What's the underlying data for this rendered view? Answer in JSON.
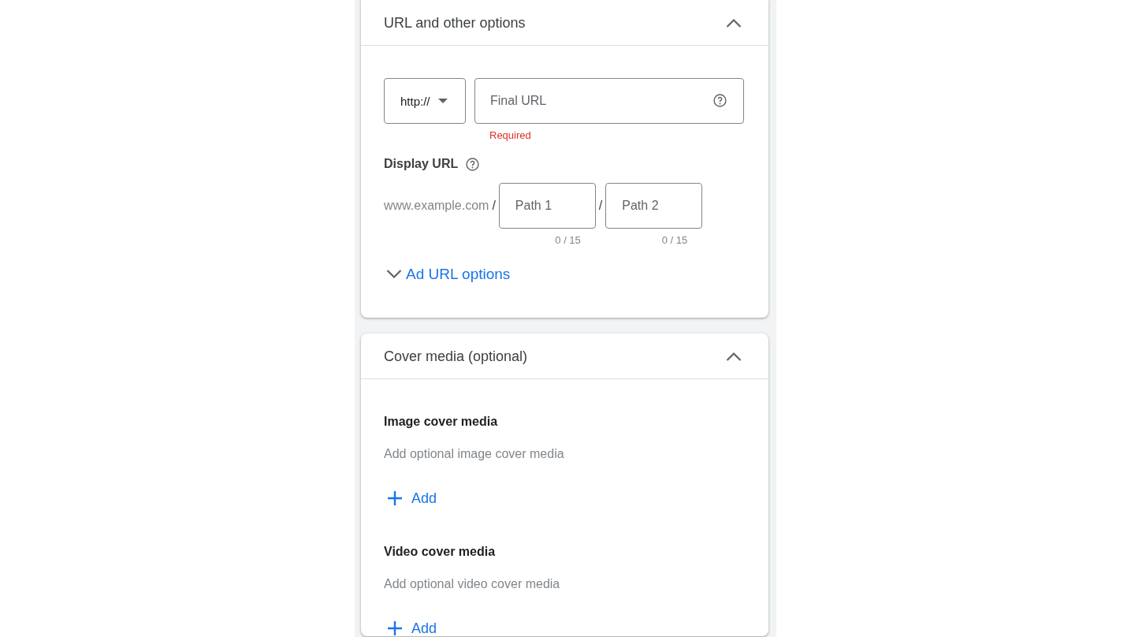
{
  "sections": [
    {
      "kind": "url_options",
      "title": "URL and other options",
      "expanded": true,
      "protocol": "http://",
      "final_url": {
        "placeholder": "Final URL",
        "error": "Required"
      },
      "display_url": {
        "label": "Display URL",
        "domain": "www.example.com",
        "paths": [
          {
            "separator": "/",
            "placeholder": "Path 1",
            "counter": "0 / 15"
          },
          {
            "separator": "/",
            "placeholder": "Path 2",
            "counter": "0 / 15"
          }
        ]
      },
      "ad_url_options": {
        "label": "Ad URL options",
        "expanded": false
      }
    },
    {
      "kind": "cover_media",
      "title": "Cover media (optional)",
      "expanded": true,
      "media": [
        {
          "title": "Image cover media",
          "hint": "Add optional image cover media",
          "add_label": "Add"
        },
        {
          "title": "Video cover media",
          "hint": "Add optional video cover media",
          "add_label": "Add"
        }
      ]
    }
  ]
}
